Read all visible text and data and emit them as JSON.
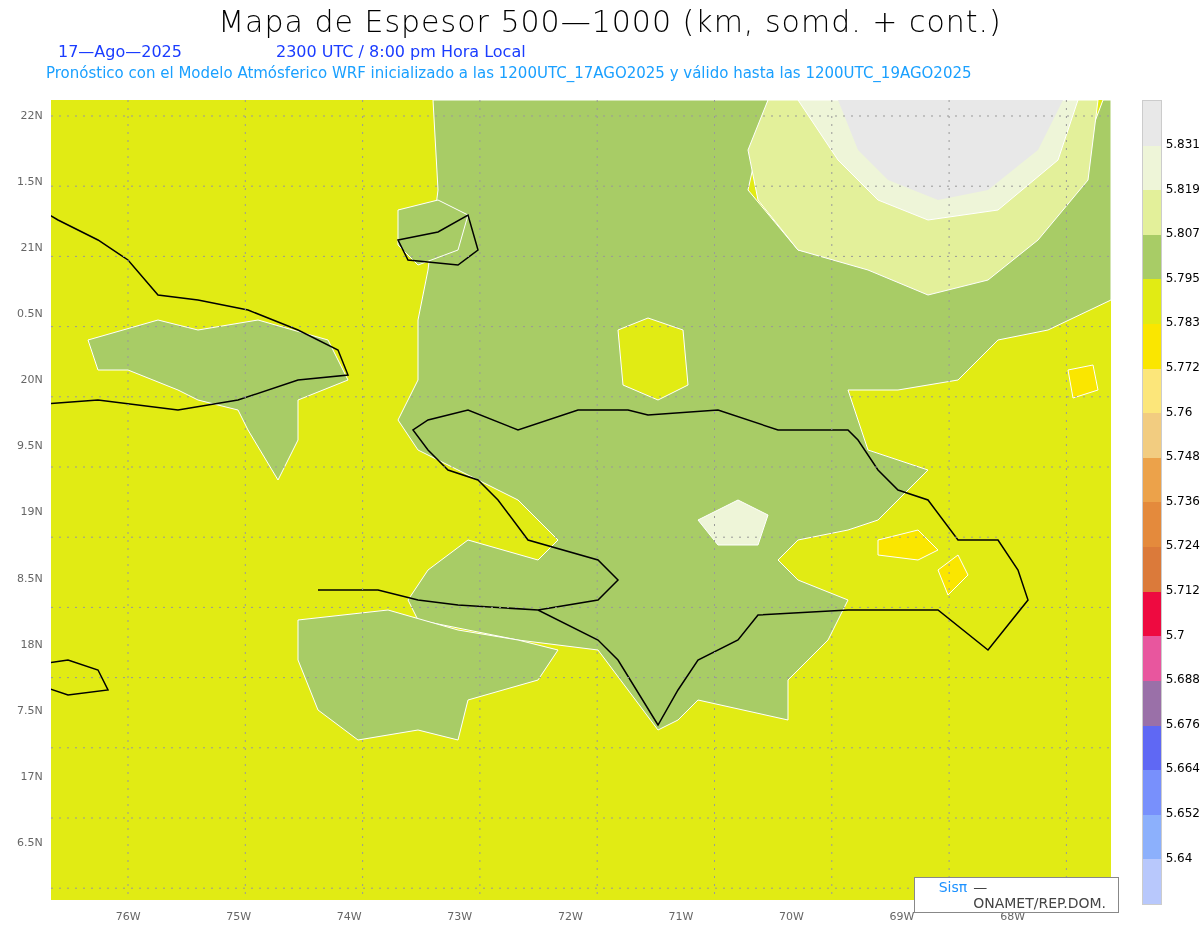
{
  "title": "Mapa de Espesor 500—1000 (km, somd. + cont.)",
  "date": "17—Ago—2025",
  "time": "2300 UTC / 8:00 pm Hora Local",
  "forecast": "Pronóstico con el Modelo Atmósferico WRF inicializado a las 1200UTC_17AGO2025 y válido hasta las  1200UTC_19AGO2025",
  "latitude_labels": [
    "22N",
    "1.5N",
    "21N",
    "0.5N",
    "20N",
    "9.5N",
    "19N",
    "8.5N",
    "18N",
    "7.5N",
    "17N",
    "6.5N"
  ],
  "longitude_labels": [
    "76W",
    "75W",
    "74W",
    "73W",
    "72W",
    "71W",
    "70W",
    "69W",
    "68W"
  ],
  "credit": {
    "brand": "Sisπ",
    "text": "— ONAMET/REP.DOM."
  },
  "legend": {
    "bins": [
      {
        "color": "#e8e8e8"
      },
      {
        "color": "#eef5d8"
      },
      {
        "color": "#e3f09a"
      },
      {
        "color": "#a8cc66"
      },
      {
        "color": "#e1eb14"
      },
      {
        "color": "#fae600"
      },
      {
        "color": "#fce67a"
      },
      {
        "color": "#f2cc80"
      },
      {
        "color": "#eca24a"
      },
      {
        "color": "#e48a3c"
      },
      {
        "color": "#db7a3a"
      },
      {
        "color": "#ee0a40"
      },
      {
        "color": "#e8569e"
      },
      {
        "color": "#9a70a8"
      },
      {
        "color": "#5f68f4"
      },
      {
        "color": "#7890fc"
      },
      {
        "color": "#8cb0fc"
      },
      {
        "color": "#b8c8fc"
      }
    ],
    "labels": [
      "5.831",
      "5.819",
      "5.807",
      "5.795",
      "5.783",
      "5.772",
      "5.76",
      "5.748",
      "5.736",
      "5.724",
      "5.712",
      "5.7",
      "5.688",
      "5.676",
      "5.664",
      "5.652",
      "5.64"
    ]
  }
}
